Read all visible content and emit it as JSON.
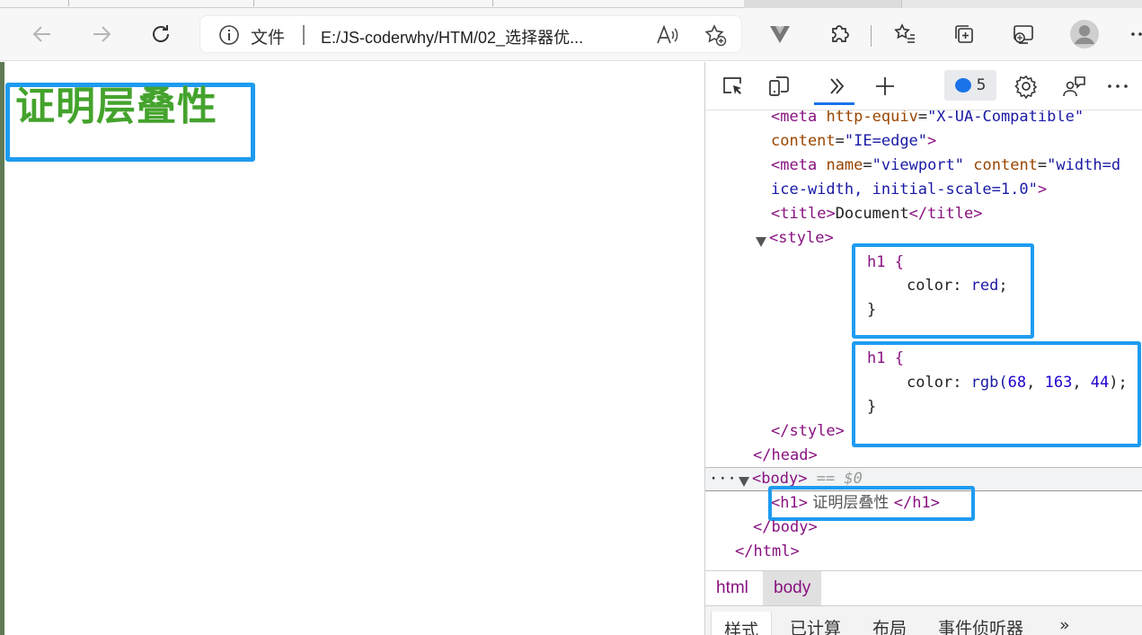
{
  "browser": {
    "address_file_label": "文件",
    "url": "E:/JS-coderwhy/HTM/02_选择器优..."
  },
  "page": {
    "h1_text": "证明层叠性",
    "h1_color": "#44a32c"
  },
  "devtools": {
    "issues_count": "5",
    "code": {
      "meta1_tag": "meta",
      "meta1_attr": "http-equiv",
      "meta1_val": "\"X-UA-Compatible\"",
      "meta1_attr2": "content",
      "meta1_val2": "\"IE=edge\"",
      "meta2_tag": "meta",
      "meta2_attr": "name",
      "meta2_val": "\"viewport\"",
      "meta2_attr2": "content",
      "meta2_val2a": "\"width=d",
      "meta2_val2b": "ice-width, initial-scale=1.0\"",
      "title_tag": "title",
      "title_text": "Document",
      "style_tag": "style",
      "rule1_selector": "h1 {",
      "rule1_prop": "color",
      "rule1_value": "red",
      "rule_close": "}",
      "rule2_selector": "h1 {",
      "rule2_prop": "color",
      "rule2_fn": "rgb(",
      "rule2_r": "68",
      "rule2_g": "163",
      "rule2_b": "44",
      "rule2_end": ");",
      "style_close": "/style",
      "head_close": "/head",
      "body_tag": "body",
      "body_eq": "== $0",
      "h1_tag": "h1",
      "h1_text": " 证明层叠性 ",
      "h1_close": "/h1",
      "body_close": "/body",
      "html_close": "/html",
      "ellipsis": "···"
    },
    "breadcrumbs": [
      "html",
      "body"
    ],
    "subtabs": [
      "样式",
      "已计算",
      "布局",
      "事件侦听器",
      "»"
    ]
  },
  "colors": {
    "highlight_box": "#1e9bf0",
    "tag": "#881280",
    "attr": "#994500",
    "value": "#1a1aa6"
  }
}
